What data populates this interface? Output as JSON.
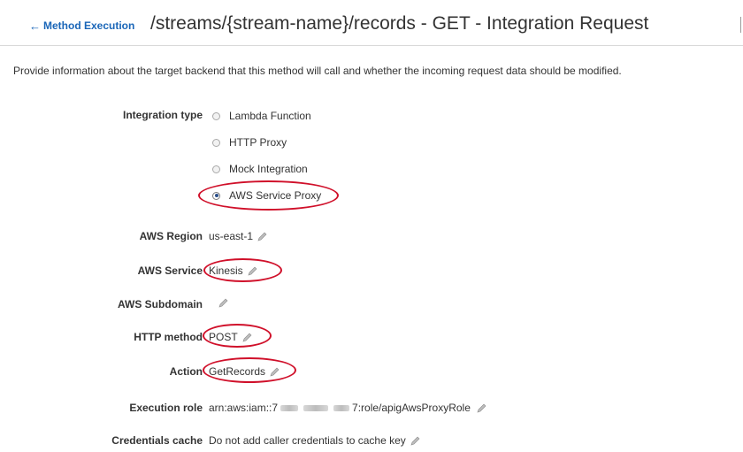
{
  "header": {
    "back_link": "Method Execution",
    "title": "/streams/{stream-name}/records - GET - Integration Request"
  },
  "description": "Provide information about the target backend that this method will call and whether the incoming request data should be modified.",
  "integration_type": {
    "label": "Integration type",
    "options": [
      {
        "label": "Lambda Function",
        "selected": false
      },
      {
        "label": "HTTP Proxy",
        "selected": false
      },
      {
        "label": "Mock Integration",
        "selected": false
      },
      {
        "label": "AWS Service Proxy",
        "selected": true
      }
    ]
  },
  "fields": {
    "aws_region": {
      "label": "AWS Region",
      "value": "us-east-1"
    },
    "aws_service": {
      "label": "AWS Service",
      "value": "Kinesis"
    },
    "aws_subdomain": {
      "label": "AWS Subdomain",
      "value": ""
    },
    "http_method": {
      "label": "HTTP method",
      "value": "POST"
    },
    "action": {
      "label": "Action",
      "value": "GetRecords"
    },
    "execution_role": {
      "label": "Execution role",
      "value_prefix": "arn:aws:iam::7",
      "value_suffix": "7:role/apigAwsProxyRole"
    },
    "credentials_cache": {
      "label": "Credentials cache",
      "value": "Do not add caller credentials to cache key"
    }
  },
  "icons": {
    "back": "left-arrow-icon",
    "edit": "pencil-icon"
  },
  "colors": {
    "link": "#1a66b8",
    "highlight": "#d0102a",
    "text": "#333333"
  }
}
